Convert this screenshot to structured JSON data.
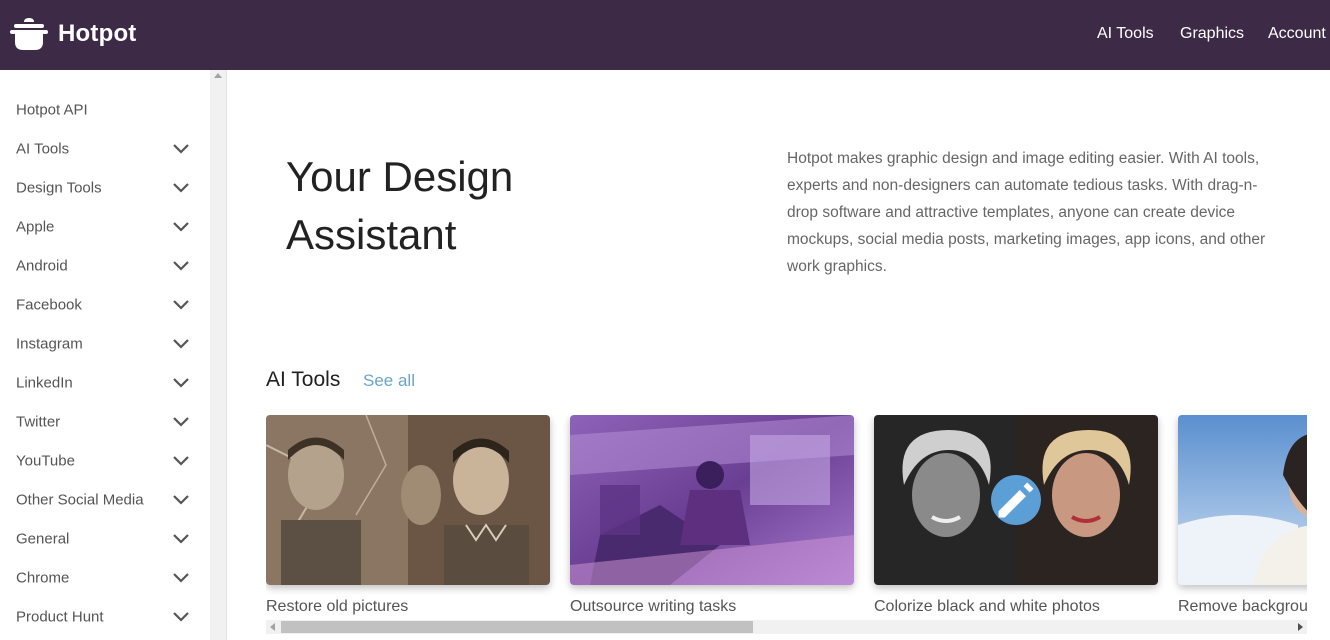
{
  "brand": {
    "name": "Hotpot",
    "bar_color": "#3d2a47",
    "accent": "#6aa4c7"
  },
  "nav": {
    "ai_tools": "AI Tools",
    "graphics": "Graphics",
    "account": "Account"
  },
  "sidebar": {
    "items": [
      {
        "label": "Hotpot API",
        "expandable": false
      },
      {
        "label": "AI Tools",
        "expandable": true
      },
      {
        "label": "Design Tools",
        "expandable": true
      },
      {
        "label": "Apple",
        "expandable": true
      },
      {
        "label": "Android",
        "expandable": true
      },
      {
        "label": "Facebook",
        "expandable": true
      },
      {
        "label": "Instagram",
        "expandable": true
      },
      {
        "label": "LinkedIn",
        "expandable": true
      },
      {
        "label": "Twitter",
        "expandable": true
      },
      {
        "label": "YouTube",
        "expandable": true
      },
      {
        "label": "Other Social Media",
        "expandable": true
      },
      {
        "label": "General",
        "expandable": true
      },
      {
        "label": "Chrome",
        "expandable": true
      },
      {
        "label": "Product Hunt",
        "expandable": true
      }
    ]
  },
  "hero": {
    "title": "Your Design Assistant",
    "description": "Hotpot makes graphic design and image editing easier. With AI tools, experts and non-designers can automate tedious tasks. With drag-n-drop software and attractive templates, anyone can create device mockups, social media posts, marketing images, app icons, and other work graphics."
  },
  "section": {
    "title": "AI Tools",
    "see_all": "See all"
  },
  "cards": [
    {
      "label": "Restore old pictures",
      "icon": "photo-restore-thumbnail"
    },
    {
      "label": "Outsource writing tasks",
      "icon": "art-painting-thumbnail"
    },
    {
      "label": "Colorize black and white photos",
      "icon": "pencil-icon"
    },
    {
      "label": "Remove background",
      "icon": "portrait-thumbnail"
    }
  ]
}
